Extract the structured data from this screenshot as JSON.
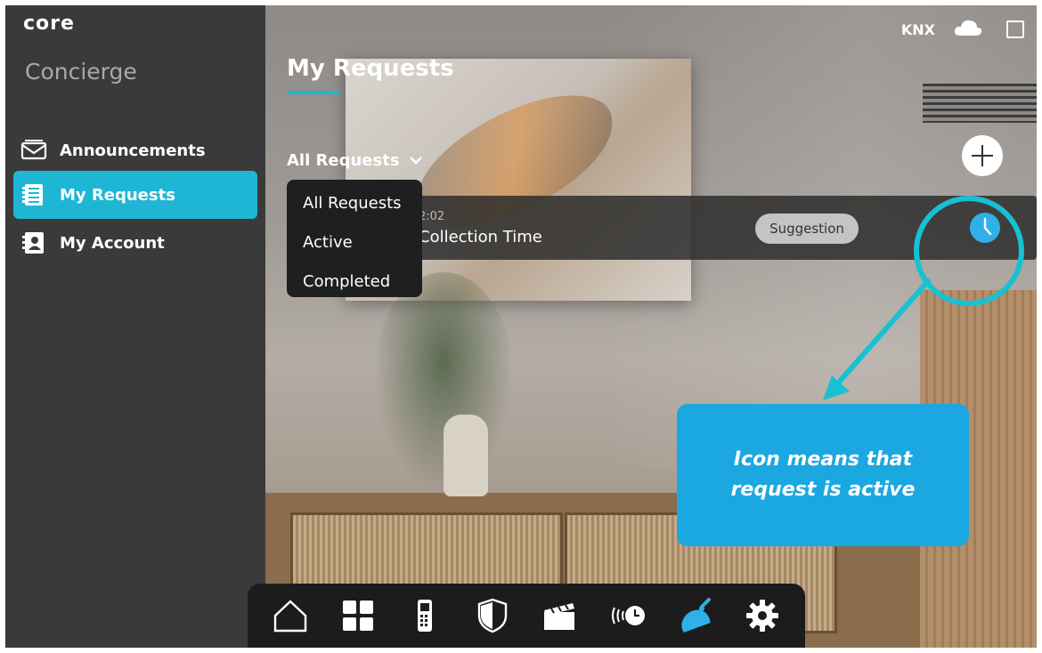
{
  "app": {
    "logo": "core"
  },
  "sidebar": {
    "section_title": "Concierge",
    "items": [
      {
        "label": "Announcements",
        "icon": "envelope-icon",
        "active": false
      },
      {
        "label": "My Requests",
        "icon": "list-icon",
        "active": true
      },
      {
        "label": "My Account",
        "icon": "contact-card-icon",
        "active": false
      }
    ]
  },
  "header": {
    "title": "My Requests",
    "status": {
      "knx": "KNX",
      "cloud_icon": "cloud-icon",
      "device_icon": "device-icon"
    }
  },
  "filter": {
    "selected": "All Requests",
    "options": [
      "All Requests",
      "Active",
      "Completed"
    ]
  },
  "requests": [
    {
      "time": "2:02",
      "name": "Collection Time",
      "badge": "Suggestion",
      "status_icon": "clock-icon"
    }
  ],
  "callout": {
    "text": "Icon means that request is active"
  },
  "dock": {
    "items": [
      "home-icon",
      "grid-icon",
      "intercom-icon",
      "shield-icon",
      "clapperboard-icon",
      "schedule-icon",
      "concierge-bell-icon",
      "settings-icon"
    ],
    "active": "concierge-bell-icon"
  },
  "colors": {
    "accent": "#1fb6d6",
    "callout": "#1ba7df",
    "sidebar": "#3a3a3a"
  }
}
